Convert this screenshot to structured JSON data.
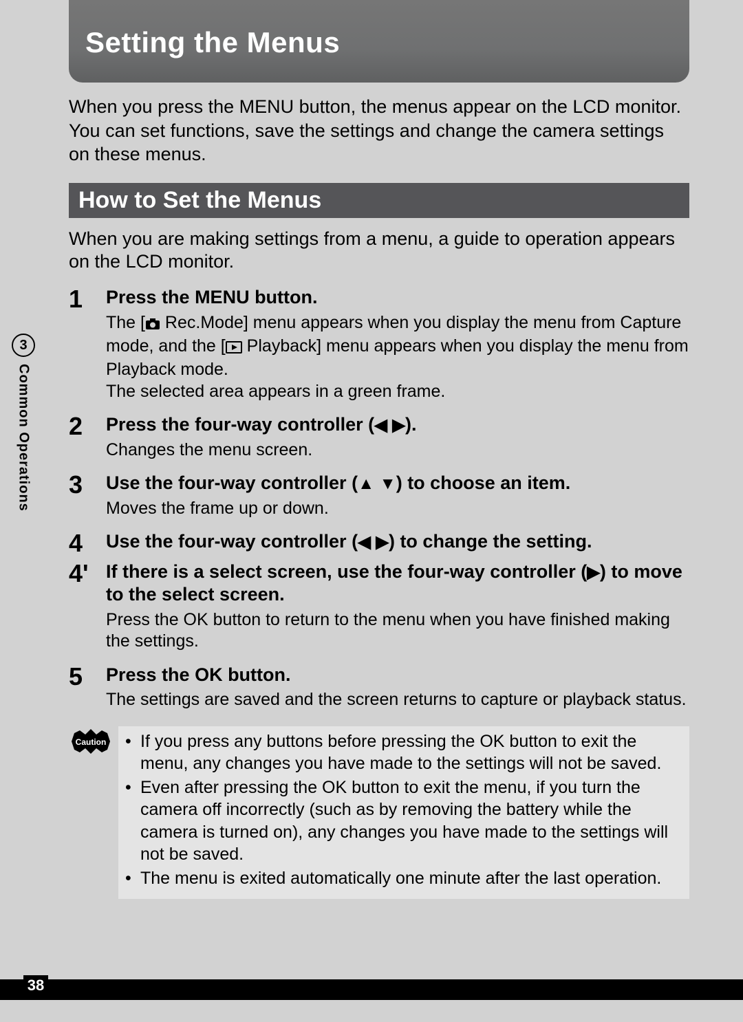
{
  "heading": "Setting the Menus",
  "intro": "When you press the MENU button, the menus appear on the LCD monitor. You can set functions, save the settings and change the camera settings on these menus.",
  "sub_heading": "How to Set the Menus",
  "sub_intro": "When you are making settings from a menu, a guide to operation appears on the LCD monitor.",
  "side": {
    "chapter_number": "3",
    "chapter_label": "Common Operations"
  },
  "page_number": "38",
  "steps": [
    {
      "num": "1",
      "title": "Press the MENU button.",
      "desc_parts": {
        "pre_icon1": "The [",
        "after_icon1": " Rec.Mode] menu appears when you display the menu from Capture mode, and the [",
        "after_icon2": " Playback] menu appears when you display the menu from Playback mode.",
        "line2": "The selected area appears in a green frame."
      }
    },
    {
      "num": "2",
      "title_parts": {
        "pre": "Press the four-way controller (",
        "post": ")."
      },
      "desc": "Changes the menu screen."
    },
    {
      "num": "3",
      "title_parts": {
        "pre": "Use the four-way controller (",
        "post": ") to choose an item."
      },
      "desc": "Moves the frame up or down."
    },
    {
      "num": "4",
      "title_parts": {
        "pre": "Use the four-way controller (",
        "post": ") to change the setting."
      }
    },
    {
      "num": "4'",
      "title_parts": {
        "pre": "If there is a select screen, use the four-way controller (",
        "post": ") to move to the select screen."
      },
      "desc": "Press the OK button to return to the menu when you have finished making the settings."
    },
    {
      "num": "5",
      "title": "Press the OK button.",
      "desc": "The settings are saved and the screen returns to capture or playback status."
    }
  ],
  "caution_label": "Caution",
  "caution_items": [
    "If you press any buttons before pressing the OK button to exit the menu, any changes you have made to the settings will not be saved.",
    "Even after pressing the OK button to exit the menu, if you turn the camera off incorrectly (such as by removing the battery while the camera is turned on), any changes you have made to the settings will not be saved.",
    "The menu is exited automatically one minute after the last operation."
  ]
}
